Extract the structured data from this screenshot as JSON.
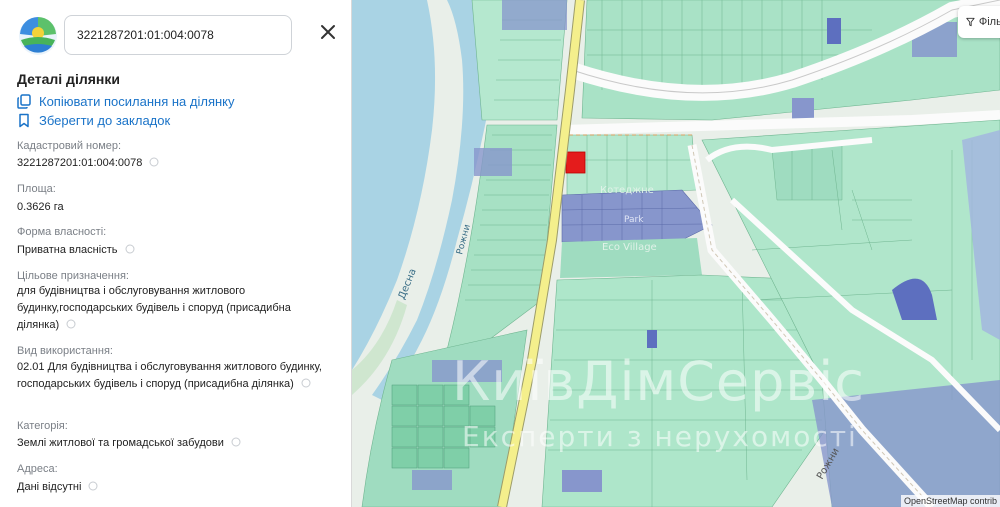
{
  "search": {
    "value": "3221287201:01:004:0078"
  },
  "panel": {
    "title": "Деталі ділянки",
    "copy_link": "Копіювати посилання на ділянку",
    "bookmark": "Зберегти до закладок",
    "fields": [
      {
        "label": "Кадастровий номер:",
        "value": "3221287201:01:004:0078"
      },
      {
        "label": "Площа:",
        "value": "0.3626 га"
      },
      {
        "label": "Форма власності:",
        "value": "Приватна власність"
      },
      {
        "label": "Цільове призначення:",
        "value": "для будівництва і обслуговування житлового будинку,господарських будівель і споруд (присадибна ділянка)"
      },
      {
        "label": "Вид використання:",
        "value": "02.01 Для будівництва і обслуговування житлового будинку, господарських будівель і споруд (присадибна ділянка)"
      },
      {
        "label": "Категорія:",
        "value": "Землі житлової та громадської забудови"
      },
      {
        "label": "Адреса:",
        "value": "Дані відсутні"
      }
    ]
  },
  "map": {
    "filter_label": "Фільт",
    "attribution": "OpenStreetMap contrib",
    "labels": {
      "river": "Десна",
      "river2": "Рожни",
      "street": "Рожни",
      "village": "Eco Village",
      "kotedzhne": "Котеджне",
      "park": "Park"
    },
    "watermark": "КиївДімСервіс",
    "watermark_sub": "Експерти з нерухомості"
  },
  "colors": {
    "accent": "#1a73c8",
    "water": "#a9d3e4",
    "parcel_green": "#9fdcc0",
    "parcel_blue": "#8796cc",
    "selected_parcel": "#e41c1c",
    "road_yellow": "#f4ef8c"
  }
}
